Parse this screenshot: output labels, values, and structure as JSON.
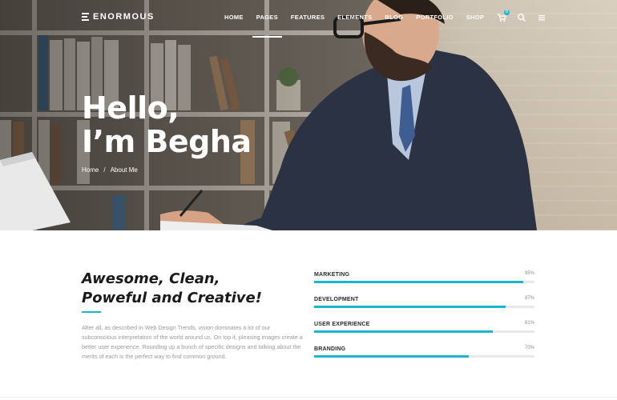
{
  "header": {
    "logo_text": "ENORMOUS",
    "nav": [
      {
        "label": "HOME",
        "active": false
      },
      {
        "label": "PAGES",
        "active": true
      },
      {
        "label": "FEATURES",
        "active": false
      },
      {
        "label": "ELEMENTS",
        "active": false
      },
      {
        "label": "BLOG",
        "active": false
      },
      {
        "label": "PORTFOLIO",
        "active": false
      },
      {
        "label": "SHOP",
        "active": false
      }
    ],
    "cart_count": "0",
    "icons": [
      "cart-icon",
      "search-icon",
      "menu-icon"
    ]
  },
  "hero": {
    "title": "Hello,\nI’m Begha",
    "breadcrumb": {
      "home": "Home",
      "separator": "/",
      "current": "About Me"
    }
  },
  "about": {
    "heading": "Awesome, Clean,\nPoweful and Creative!",
    "text": "After all, as described in Web Design Trends, vision dominates a lot of our subconscious interpretation of the world around us. On top it, pleasing images create a better user experience. Rounding up a bunch of specific designs and talking about the merits of each is the perfect way to find common ground."
  },
  "skills": [
    {
      "label": "MARKETING",
      "percent_text": "95%",
      "value": 95
    },
    {
      "label": "DEVELOPMENT",
      "percent_text": "87%",
      "value": 87
    },
    {
      "label": "USER EXPERIENCE",
      "percent_text": "81%",
      "value": 81
    },
    {
      "label": "BRANDING",
      "percent_text": "70%",
      "value": 70
    }
  ],
  "colors": {
    "accent": "#19b6d3",
    "heading": "#1a1a1a",
    "body_text": "#9a9a9a"
  }
}
